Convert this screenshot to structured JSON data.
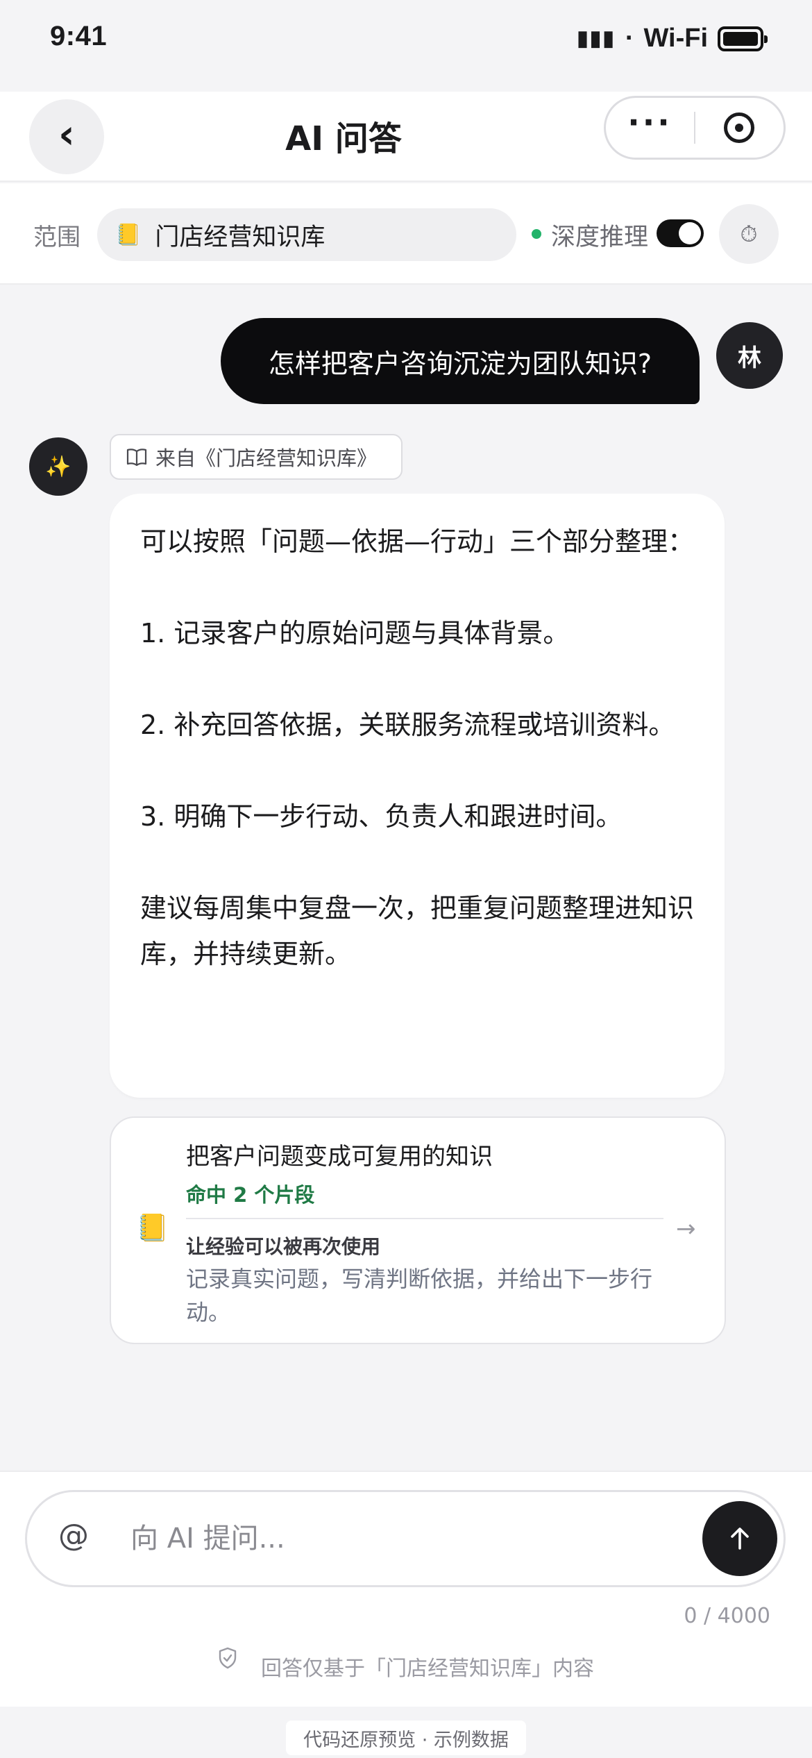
{
  "status_bar": {
    "time": "9:41",
    "signal": "▮▮▮",
    "separator": "·",
    "wifi": "Wi-Fi"
  },
  "nav": {
    "back": "‹",
    "title": "AI 问答",
    "more": "···"
  },
  "scope": {
    "label": "范围",
    "icon": "📒",
    "value": "门店经营知识库",
    "deep_label": "深度推理",
    "deep_on": true,
    "history_icon": "⏱"
  },
  "user_message": {
    "text": "怎样把客户咨询沉淀为团队知识?",
    "avatar": "林"
  },
  "ai_message": {
    "avatar_icon": "✨",
    "source": "来自《门店经营知识库》",
    "paragraphs": [
      "可以按照「问题—依据—行动」三个部分整理：",
      "1. 记录客户的原始问题与具体背景。",
      "2. 补充回答依据，关联服务流程或培训资料。",
      "3. 明确下一步行动、负责人和跟进时间。",
      "建议每周集中复盘一次，把重复问题整理进知识库，并持续更新。"
    ]
  },
  "kb_card": {
    "icon": "📒",
    "title": "把客户问题变成可复用的知识",
    "hits": "命中 2 个片段",
    "subtitle": "让经验可以被再次使用",
    "description": "记录真实问题，写清判断依据，并给出下一步行动。",
    "arrow": "→"
  },
  "input": {
    "at": "@",
    "placeholder": "向 AI 提问...",
    "count": "0 / 4000"
  },
  "note": "回答仅基于「门店经营知识库」内容",
  "footer": "代码还原预览 · 示例数据"
}
